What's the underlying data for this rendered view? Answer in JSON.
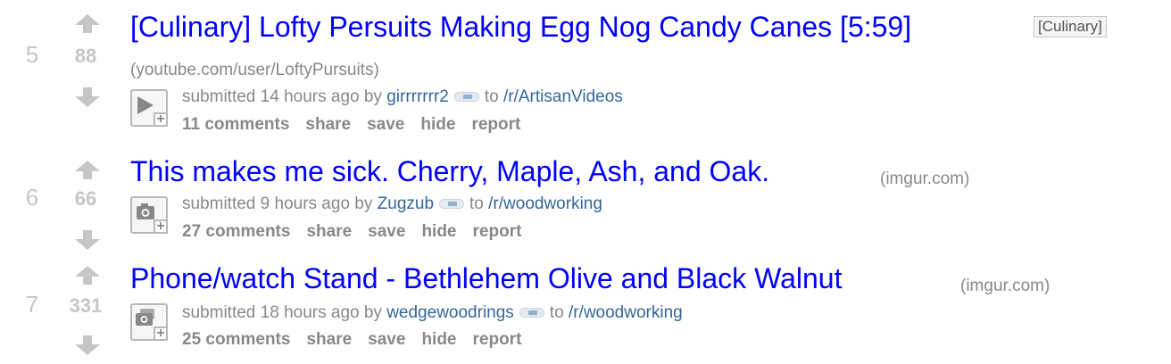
{
  "posts": [
    {
      "rank": "5",
      "score": "88",
      "title": "[Culinary] Lofty Persuits Making Egg Nog Candy Canes [5:59]",
      "flair": "[Culinary]",
      "domain": "(youtube.com/user/LoftyPursuits)",
      "thumb_icon": "play-icon",
      "submitted": "submitted 14 hours ago by",
      "author": "girrrrrrr2",
      "to": "to",
      "subreddit": "/r/ArtisanVideos",
      "comments": "11 comments",
      "share": "share",
      "save": "save",
      "hide": "hide",
      "report": "report"
    },
    {
      "rank": "6",
      "score": "66",
      "title": "This makes me sick. Cherry, Maple, Ash, and Oak.",
      "domain": "(imgur.com)",
      "thumb_icon": "camera-icon",
      "submitted": "submitted 9 hours ago by",
      "author": "Zugzub",
      "to": "to",
      "subreddit": "/r/woodworking",
      "comments": "27 comments",
      "share": "share",
      "save": "save",
      "hide": "hide",
      "report": "report"
    },
    {
      "rank": "7",
      "score": "331",
      "title": "Phone/watch Stand - Bethlehem Olive and Black Walnut",
      "domain": "(imgur.com)",
      "thumb_icon": "gallery-icon",
      "submitted": "submitted 18 hours ago by",
      "author": "wedgewoodrings",
      "to": "to",
      "subreddit": "/r/woodworking",
      "comments": "25 comments",
      "share": "share",
      "save": "save",
      "hide": "hide",
      "report": "report"
    }
  ],
  "colors": {
    "title": "#0000ff",
    "link": "#336699",
    "muted": "#888888",
    "vote": "#c6c6c6"
  }
}
